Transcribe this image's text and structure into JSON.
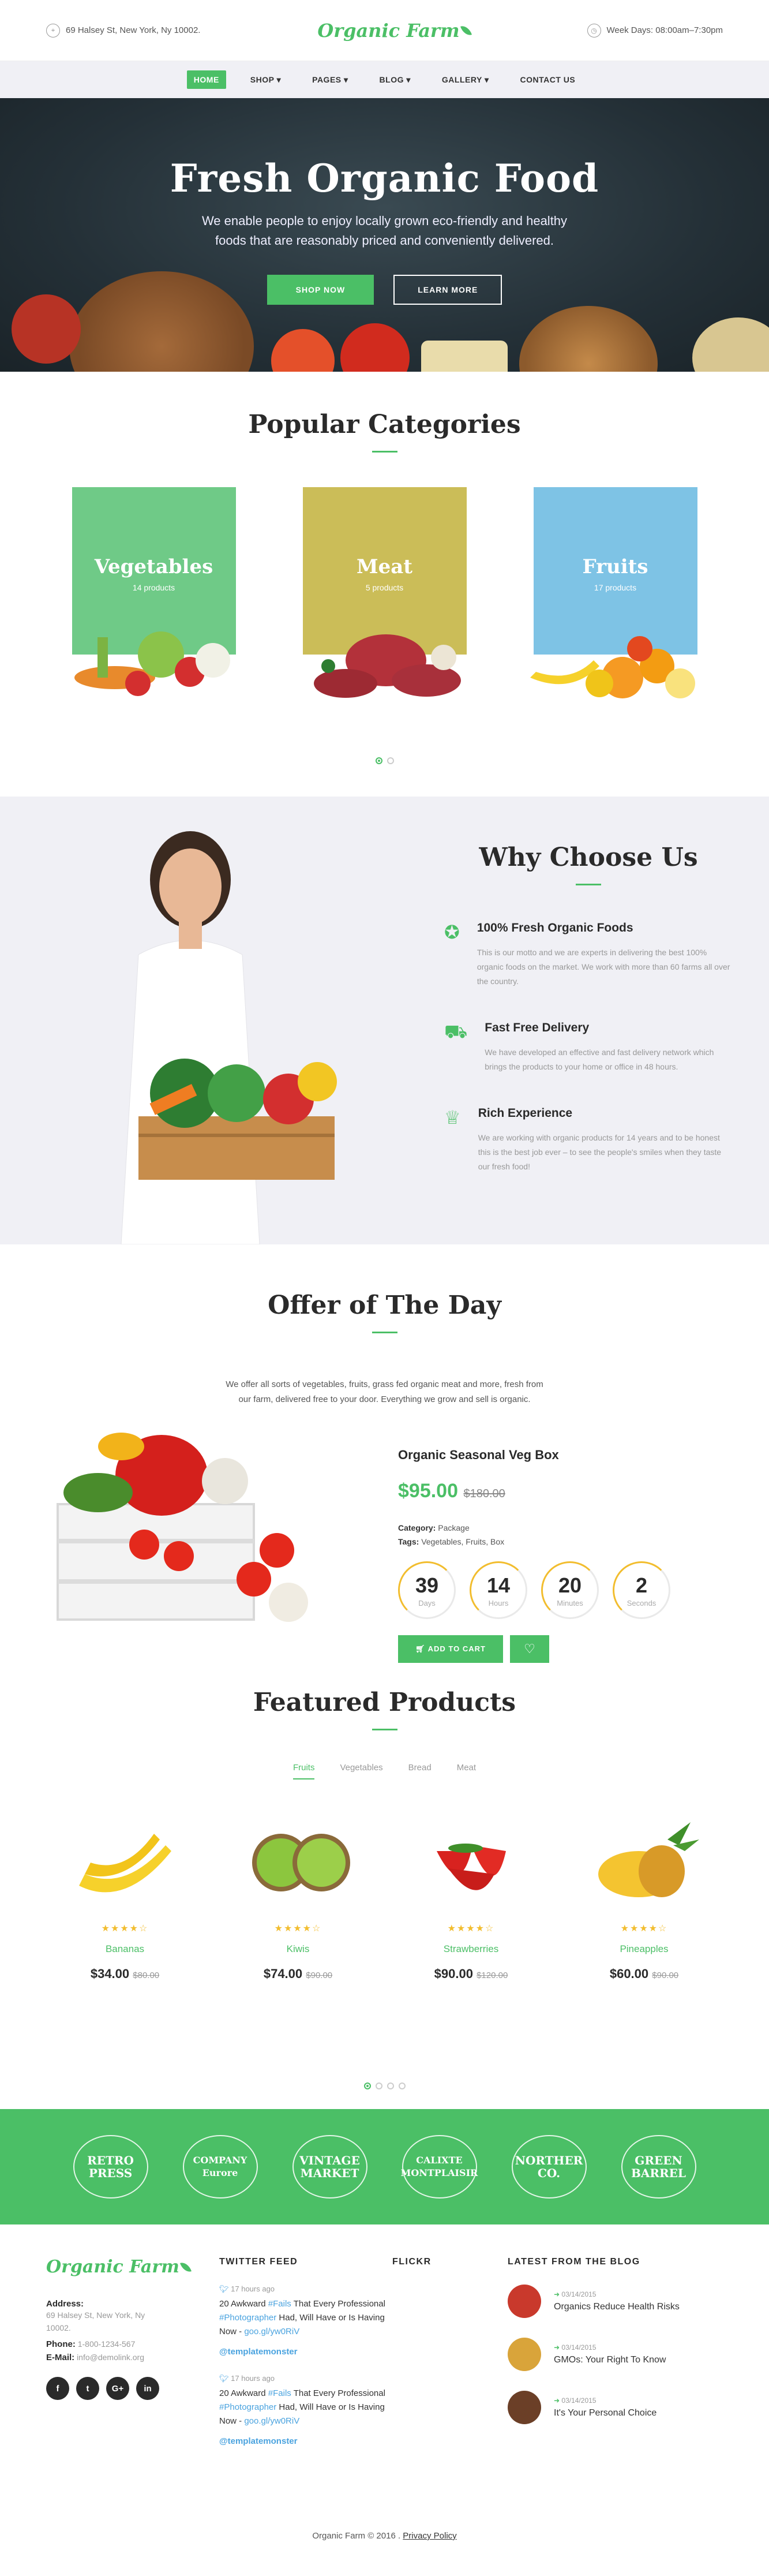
{
  "topbar": {
    "address": "69 Halsey St, New York, Ny 10002.",
    "logo": "Organic Farm",
    "hours": "Week Days: 08:00am–7:30pm"
  },
  "nav": [
    "HOME",
    "SHOP",
    "PAGES",
    "BLOG",
    "GALLERY",
    "CONTACT US"
  ],
  "hero": {
    "title": "Fresh Organic Food",
    "subtitle_line1": "We enable people to enjoy locally grown eco-friendly and healthy",
    "subtitle_line2": "foods that are reasonably priced and conveniently delivered.",
    "btn_primary": "SHOP NOW",
    "btn_secondary": "LEARN MORE"
  },
  "categories": {
    "title": "Popular Categories",
    "items": [
      {
        "name": "Vegetables",
        "count": "14 products",
        "color": "#6fca87"
      },
      {
        "name": "Meat",
        "count": "5 products",
        "color": "#cbbd58"
      },
      {
        "name": "Fruits",
        "count": "17 products",
        "color": "#7ec3e5"
      }
    ]
  },
  "why": {
    "title": "Why Choose Us",
    "items": [
      {
        "icon": "badge-icon",
        "title": "100% Fresh Organic Foods",
        "text": "This is our motto and we are experts in delivering the best 100% organic foods on the market. We work with more than 60 farms all over the country."
      },
      {
        "icon": "truck-icon",
        "title": "Fast Free Delivery",
        "text": "We have developed an effective and fast delivery network which brings the products to your home or office in 48 hours."
      },
      {
        "icon": "trophy-icon",
        "title": "Rich Experience",
        "text": "We are working with organic products for 14 years and to be honest this is the best job ever – to see the people's smiles when they taste our fresh food!"
      }
    ]
  },
  "offer": {
    "title": "Offer of The Day",
    "description": "We offer all sorts of vegetables, fruits, grass fed organic meat and more, fresh from our farm, delivered free to your door. Everything we grow and sell is organic.",
    "product": "Organic Seasonal Veg Box",
    "price": "$95.00",
    "old_price": "$180.00",
    "category_label": "Category:",
    "category": "Package",
    "tags_label": "Tags:",
    "tags": "Vegetables, Fruits, Box",
    "countdown": [
      {
        "value": "39",
        "unit": "Days"
      },
      {
        "value": "14",
        "unit": "Hours"
      },
      {
        "value": "20",
        "unit": "Minutes"
      },
      {
        "value": "2",
        "unit": "Seconds"
      }
    ],
    "cart_label": "ADD TO CART"
  },
  "featured": {
    "title": "Featured Products",
    "tabs": [
      "Fruits",
      "Vegetables",
      "Bread",
      "Meat"
    ],
    "products": [
      {
        "name": "Bananas",
        "price": "$34.00",
        "old": "$80.00",
        "rating": 4.5
      },
      {
        "name": "Kiwis",
        "price": "$74.00",
        "old": "$90.00",
        "rating": 4.5
      },
      {
        "name": "Strawberries",
        "price": "$90.00",
        "old": "$120.00",
        "rating": 4.5
      },
      {
        "name": "Pineapples",
        "price": "$60.00",
        "old": "$90.00",
        "rating": 4.5
      }
    ]
  },
  "brands": [
    "RETRO PRESS",
    "COMPANY Eurore",
    "VINTAGE MARKET",
    "CALIXTE MONTPLAISIR",
    "NORTHER CO.",
    "GREEN BARREL"
  ],
  "footer": {
    "logo": "Organic Farm",
    "address_label": "Address:",
    "address": "69 Halsey St, New York, Ny 10002.",
    "phone_label": "Phone:",
    "phone": "1-800-1234-567",
    "email_label": "E-Mail:",
    "email": "info@demolink.org",
    "twitter_title": "TWITTER FEED",
    "tweets": [
      {
        "time": "17 hours ago",
        "pre": "20 Awkward ",
        "tag1": "#Fails",
        "mid": " That Every Professional ",
        "tag2": "#Photographer",
        "post": " Had, Will Have or Is Having Now - ",
        "link": "goo.gl/yw0RiV",
        "handle": "@templatemonster"
      },
      {
        "time": "17 hours ago",
        "pre": "20 Awkward ",
        "tag1": "#Fails",
        "mid": " That Every Professional ",
        "tag2": "#Photographer",
        "post": " Had, Will Have or Is Having Now - ",
        "link": "goo.gl/yw0RiV",
        "handle": "@templatemonster"
      }
    ],
    "flickr_title": "FLICKR",
    "blog_title": "LATEST FROM THE BLOG",
    "posts": [
      {
        "date": "03/14/2015",
        "title": "Organics Reduce Health Risks",
        "color": "#c9392c"
      },
      {
        "date": "03/14/2015",
        "title": "GMOs: Your Right To Know",
        "color": "#d9a43a"
      },
      {
        "date": "03/14/2015",
        "title": "It's Your Personal Choice",
        "color": "#6b3f27"
      }
    ],
    "copyright": "Organic Farm © 2016 .",
    "privacy": "Privacy Policy"
  }
}
